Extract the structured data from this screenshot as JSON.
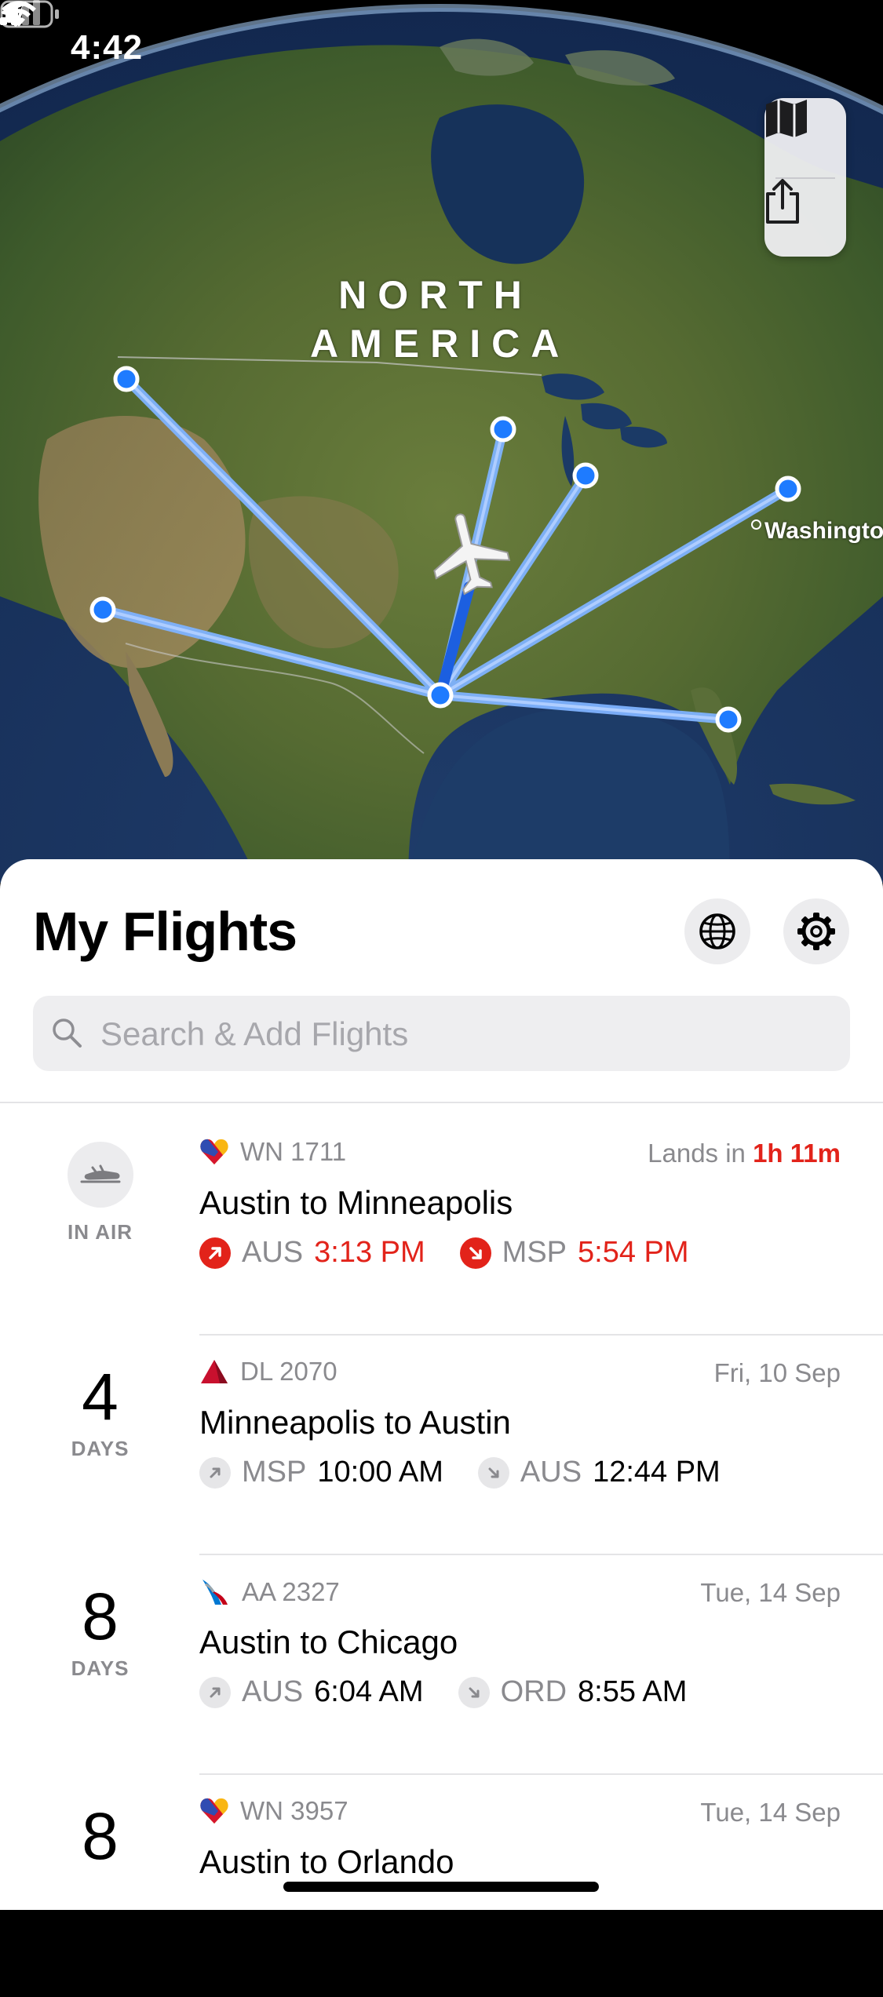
{
  "status_bar": {
    "time": "4:42"
  },
  "map": {
    "region_label_line1": "NORTH",
    "region_label_line2": "AMERICA",
    "city_label": "Washington"
  },
  "sheet": {
    "title": "My Flights",
    "search_placeholder": "Search & Add Flights"
  },
  "flights": [
    {
      "status_caption": "IN AIR",
      "airline_icon": "southwest-heart-icon",
      "flight_number": "WN 1711",
      "right_prefix": "Lands in",
      "right_value": "1h 11m",
      "route": "Austin to Minneapolis",
      "depart_code": "AUS",
      "depart_time": "3:13 PM",
      "arrive_code": "MSP",
      "arrive_time": "5:54 PM",
      "accent": "#e2231a"
    },
    {
      "days": "4",
      "days_caption": "DAYS",
      "airline_icon": "delta-triangle-icon",
      "flight_number": "DL 2070",
      "date": "Fri, 10 Sep",
      "route": "Minneapolis to Austin",
      "depart_code": "MSP",
      "depart_time": "10:00 AM",
      "arrive_code": "AUS",
      "arrive_time": "12:44 PM"
    },
    {
      "days": "8",
      "days_caption": "DAYS",
      "airline_icon": "american-airlines-icon",
      "flight_number": "AA 2327",
      "date": "Tue, 14 Sep",
      "route": "Austin to Chicago",
      "depart_code": "AUS",
      "depart_time": "6:04 AM",
      "arrive_code": "ORD",
      "arrive_time": "8:55 AM"
    },
    {
      "days": "8",
      "airline_icon": "southwest-heart-icon",
      "flight_number": "WN 3957",
      "date": "Tue, 14 Sep",
      "route": "Austin to Orlando"
    }
  ]
}
